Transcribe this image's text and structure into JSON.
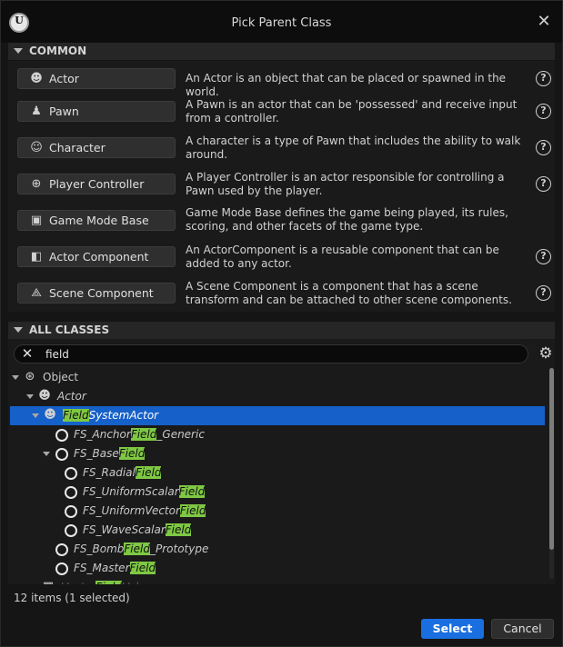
{
  "window": {
    "title": "Pick Parent Class",
    "logo_letter": "U"
  },
  "common": {
    "header": "COMMON",
    "items": [
      {
        "label": "Actor",
        "icon": "actor-icon",
        "description": "An Actor is an object that can be placed or spawned in the world.",
        "help": true
      },
      {
        "label": "Pawn",
        "icon": "pawn-icon",
        "description": "A Pawn is an actor that can be 'possessed' and receive input from a controller.",
        "help": true
      },
      {
        "label": "Character",
        "icon": "character-icon",
        "description": "A character is a type of Pawn that includes the ability to walk around.",
        "help": true
      },
      {
        "label": "Player Controller",
        "icon": "gamepad-icon",
        "description": "A Player Controller is an actor responsible for controlling a Pawn used by the player.",
        "help": true
      },
      {
        "label": "Game Mode Base",
        "icon": "game-mode-icon",
        "description": "Game Mode Base defines the game being played, its rules, scoring, and other facets of the game type.",
        "help": false
      },
      {
        "label": "Actor Component",
        "icon": "actor-component-icon",
        "description": "An ActorComponent is a reusable component that can be added to any actor.",
        "help": true
      },
      {
        "label": "Scene Component",
        "icon": "scene-component-icon",
        "description": "A Scene Component is a component that has a scene transform and can be attached to other scene components.",
        "help": true
      }
    ]
  },
  "all_classes": {
    "header": "ALL CLASSES",
    "search_value": "field",
    "tree": [
      {
        "pre": "Object",
        "match": "",
        "post": "",
        "depth": 0,
        "icon": "object-icon",
        "italic": false,
        "expanded": true
      },
      {
        "pre": "Actor",
        "match": "",
        "post": "",
        "depth": 1,
        "icon": "actor-icon",
        "italic": true,
        "expanded": true
      },
      {
        "pre": "",
        "match": "Field",
        "post": "SystemActor",
        "depth": 2,
        "icon": "actor-icon",
        "italic": true,
        "expanded": true,
        "selected": true
      },
      {
        "pre": "FS_Anchor",
        "match": "Field",
        "post": "_Generic",
        "depth": 3,
        "icon": "circle-icon",
        "italic": true
      },
      {
        "pre": "FS_Base",
        "match": "Field",
        "post": "",
        "depth": 3,
        "icon": "circle-icon",
        "italic": true,
        "expanded": true
      },
      {
        "pre": "FS_Radial",
        "match": "Field",
        "post": "",
        "depth": 4,
        "icon": "circle-icon",
        "italic": true
      },
      {
        "pre": "FS_UniformScalar",
        "match": "Field",
        "post": "",
        "depth": 4,
        "icon": "circle-icon",
        "italic": true
      },
      {
        "pre": "FS_UniformVector",
        "match": "Field",
        "post": "",
        "depth": 4,
        "icon": "circle-icon",
        "italic": true
      },
      {
        "pre": "FS_WaveScalar",
        "match": "Field",
        "post": "",
        "depth": 4,
        "icon": "circle-icon",
        "italic": true
      },
      {
        "pre": "FS_Bomb",
        "match": "Field",
        "post": "_Prototype",
        "depth": 3,
        "icon": "circle-icon",
        "italic": true
      },
      {
        "pre": "FS_Master",
        "match": "Field",
        "post": "",
        "depth": 3,
        "icon": "circle-icon",
        "italic": true
      },
      {
        "pre": "Vector",
        "match": "Field",
        "post": "Volume",
        "depth": 2,
        "icon": "volume-icon",
        "italic": true,
        "faded": true
      }
    ]
  },
  "status": "12 items (1 selected)",
  "buttons": {
    "select": "Select",
    "cancel": "Cancel"
  }
}
